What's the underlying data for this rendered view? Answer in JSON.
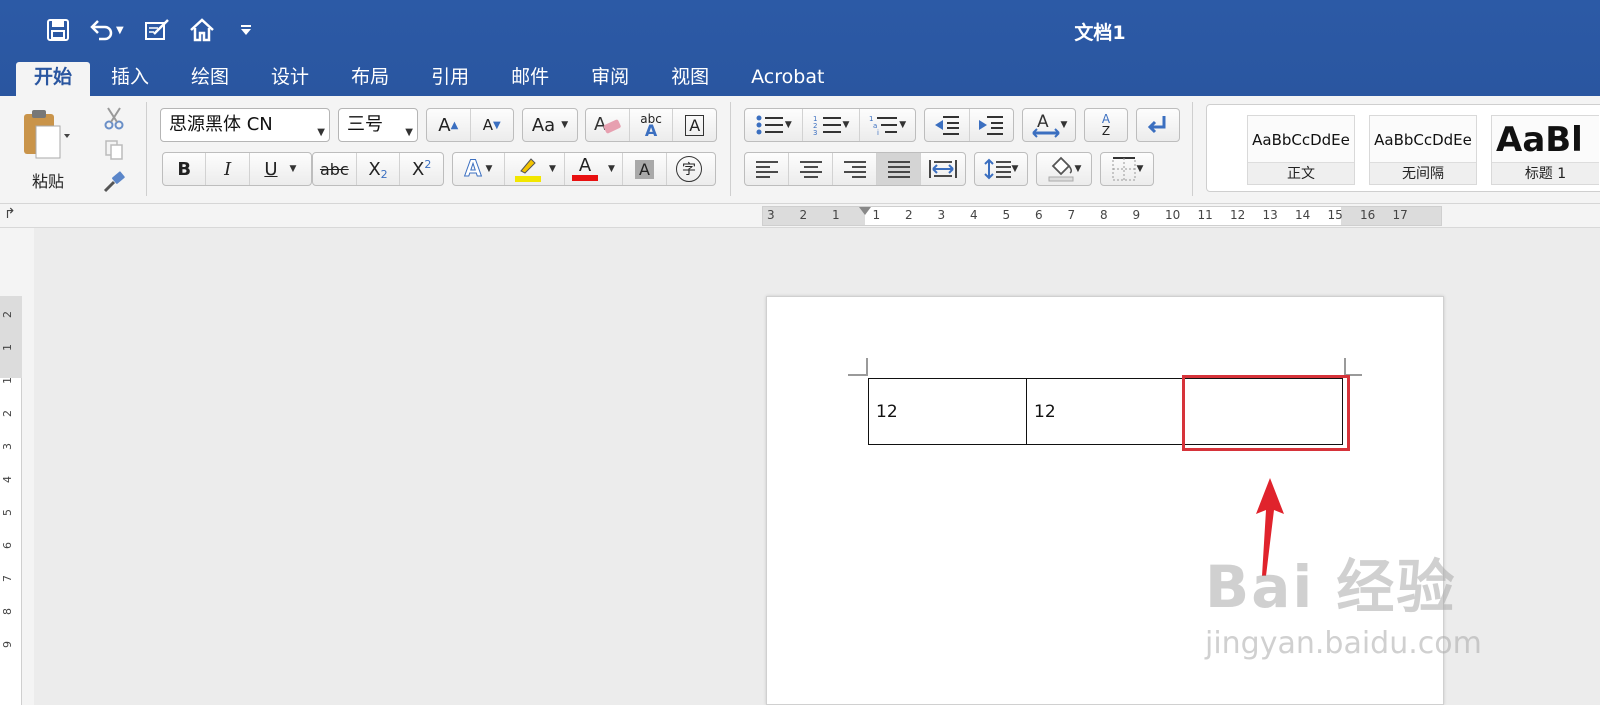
{
  "window": {
    "title": "文档1"
  },
  "quick_access": {
    "save_icon": "save-icon",
    "undo_icon": "undo-icon",
    "edit_icon": "edit-doc-icon",
    "home_icon": "home-icon",
    "customize_icon": "customize-icon"
  },
  "tabs": [
    {
      "label": "开始",
      "active": true
    },
    {
      "label": "插入"
    },
    {
      "label": "绘图"
    },
    {
      "label": "设计"
    },
    {
      "label": "布局"
    },
    {
      "label": "引用"
    },
    {
      "label": "邮件"
    },
    {
      "label": "审阅"
    },
    {
      "label": "视图"
    },
    {
      "label": "Acrobat"
    }
  ],
  "ribbon": {
    "paste_label": "粘贴",
    "font_name": "思源黑体 CN",
    "font_size": "三号",
    "bold": "B",
    "italic": "I",
    "underline": "U",
    "strike": "abc",
    "subscript": "X",
    "subscript_2": "2",
    "superscript": "X",
    "superscript_2": "2",
    "char_border": "字",
    "char_shade": "A",
    "grow_font": "A",
    "shrink_font": "A",
    "change_case": "Aa",
    "phonetic": "abc",
    "text_effect": "A",
    "font_color": "A",
    "highlight_color": "#f2e600",
    "font_color_value": "#e81010",
    "sort_letters_a": "A",
    "sort_letters_z": "Z"
  },
  "styles": [
    {
      "sample": "AaBbCcDdEe",
      "name": "正文"
    },
    {
      "sample": "AaBbCcDdEe",
      "name": "无间隔"
    },
    {
      "sample": "AaBl",
      "name": "标题 1"
    }
  ],
  "ruler": {
    "h_labels": [
      "3",
      "2",
      "1",
      "1",
      "2",
      "3",
      "4",
      "5",
      "6",
      "7",
      "8",
      "9",
      "10",
      "11",
      "12",
      "13",
      "14",
      "15",
      "16",
      "17"
    ],
    "v_labels": [
      "2",
      "1",
      "1",
      "2",
      "3",
      "4",
      "5",
      "6",
      "7",
      "8",
      "9"
    ]
  },
  "document": {
    "table": {
      "rows": [
        [
          "12",
          "12",
          ""
        ]
      ]
    }
  },
  "annotation": {
    "color": "#d6333a"
  },
  "watermark": {
    "line1": "Bai 经验",
    "line2": "jingyan.baidu.com"
  }
}
